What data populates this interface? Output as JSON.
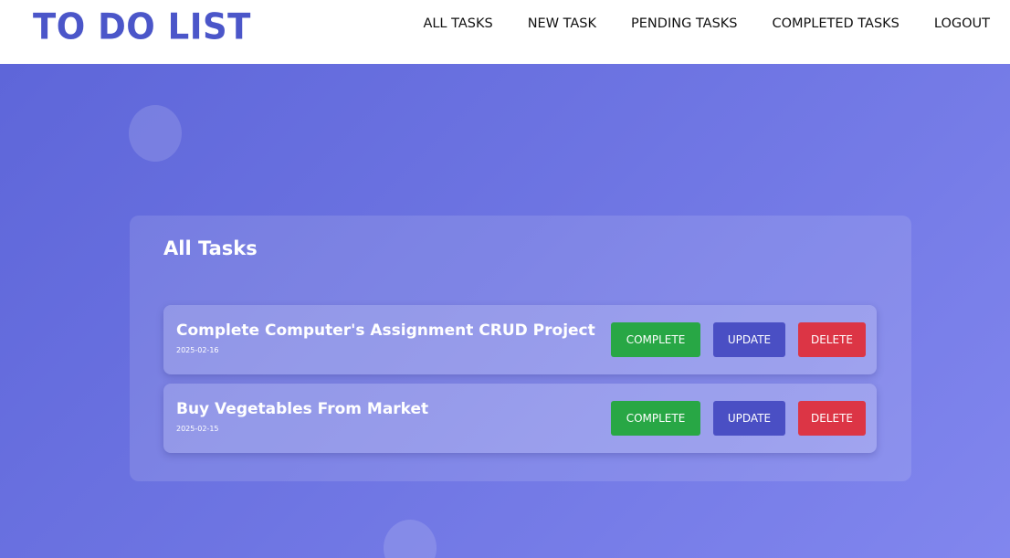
{
  "app": {
    "logo": "TO DO LIST"
  },
  "nav": {
    "links": [
      "ALL TASKS",
      "NEW TASK",
      "PENDING TASKS",
      "COMPLETED TASKS",
      "LOGOUT"
    ]
  },
  "main": {
    "title": "All Tasks",
    "tasks": [
      {
        "title": "Complete Computer's Assignment CRUD Project",
        "date": "2025-02-16"
      },
      {
        "title": "Buy Vegetables From Market",
        "date": "2025-02-15"
      }
    ]
  },
  "actions": {
    "complete": "COMPLETE",
    "update": "UPDATE",
    "delete": "DELETE"
  },
  "colors": {
    "brand": "#4b56c9",
    "complete": "#28a745",
    "update": "#4a4fc4",
    "delete": "#dc3545"
  }
}
